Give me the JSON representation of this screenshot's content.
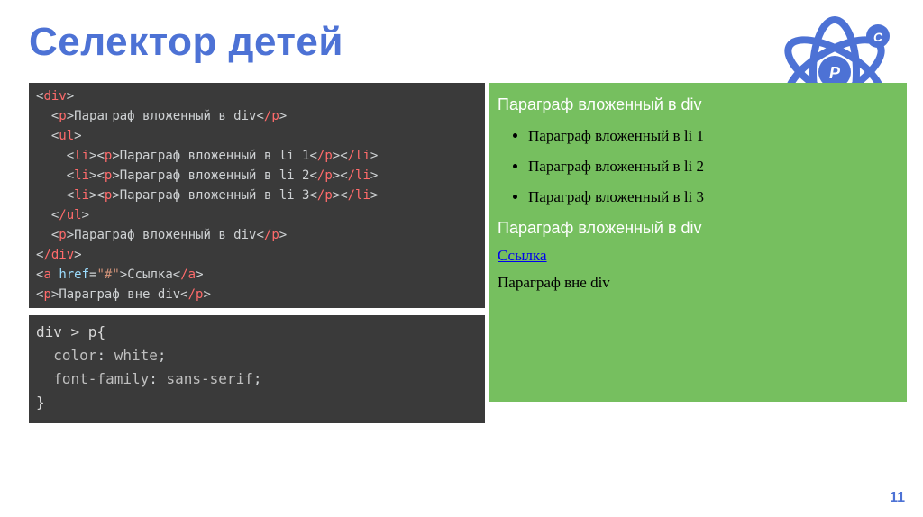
{
  "slide": {
    "title": "Селектор детей",
    "page_number": "11"
  },
  "code_html": {
    "line1a": "<div>",
    "line2_text": "Параграф вложенный в div",
    "line3a": "<ul>",
    "line4_text": "Параграф вложенный в li 1",
    "line5_text": "Параграф вложенный в li 2",
    "line6_text": "Параграф вложенный в li 3",
    "line7a": "</ul>",
    "line8_text": "Параграф вложенный в div",
    "line9a": "</div>",
    "line10_text": "Ссылка",
    "line11_text": "Параграф вне div",
    "tags": {
      "div_open": "div",
      "div_close": "/div",
      "p_open": "p",
      "p_close": "/p",
      "ul_open": "ul",
      "ul_close": "/ul",
      "li_open": "li",
      "li_close": "/li",
      "a_open": "a",
      "a_close": "/a",
      "href_attr": "href",
      "href_val": "\"#\""
    }
  },
  "code_css": {
    "selector": "div > p",
    "open_brace": "{",
    "prop1": "color",
    "val1": "white",
    "prop2": "font-family",
    "val2": "sans-serif",
    "close_brace": "}"
  },
  "preview": {
    "p1": "Параграф вложенный в div",
    "li1": "Параграф вложенный в li 1",
    "li2": "Параграф вложенный в li 2",
    "li3": "Параграф вложенный в li 3",
    "p2": "Параграф вложенный в div",
    "link": "Ссылка",
    "p3": "Параграф вне div"
  }
}
